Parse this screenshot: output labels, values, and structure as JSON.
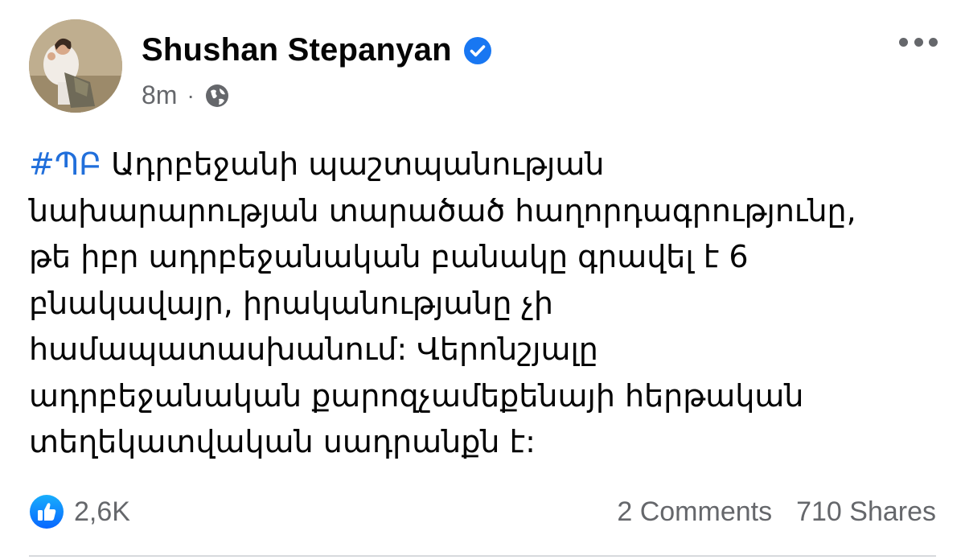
{
  "post": {
    "author": {
      "name": "Shushan Stepanyan",
      "verified": true
    },
    "timestamp": "8m",
    "separator": "·",
    "audience_icon": "globe-icon",
    "hashtag": "#ՊԲ",
    "text_lines": [
      " Ադրբեջանի պաշտպանության",
      "նախարարության տարածած հաղորդագրությունը,",
      "թե իբր ադրբեջանական բանակը գրավել է 6",
      "բնակավայր, իրականությանը չի",
      "համապատասխանում: Վերոնշյալը",
      "ադրբեջանական քարոզչամեքենայի հերթական",
      "տեղեկատվական սադրանքն է:"
    ],
    "reactions": {
      "icon": "like-icon",
      "count": "2,6K"
    },
    "comments": "2 Comments",
    "shares": "710 Shares"
  },
  "colors": {
    "accent": "#1877f2",
    "hashtag": "#216fdb",
    "muted": "#65676b"
  }
}
